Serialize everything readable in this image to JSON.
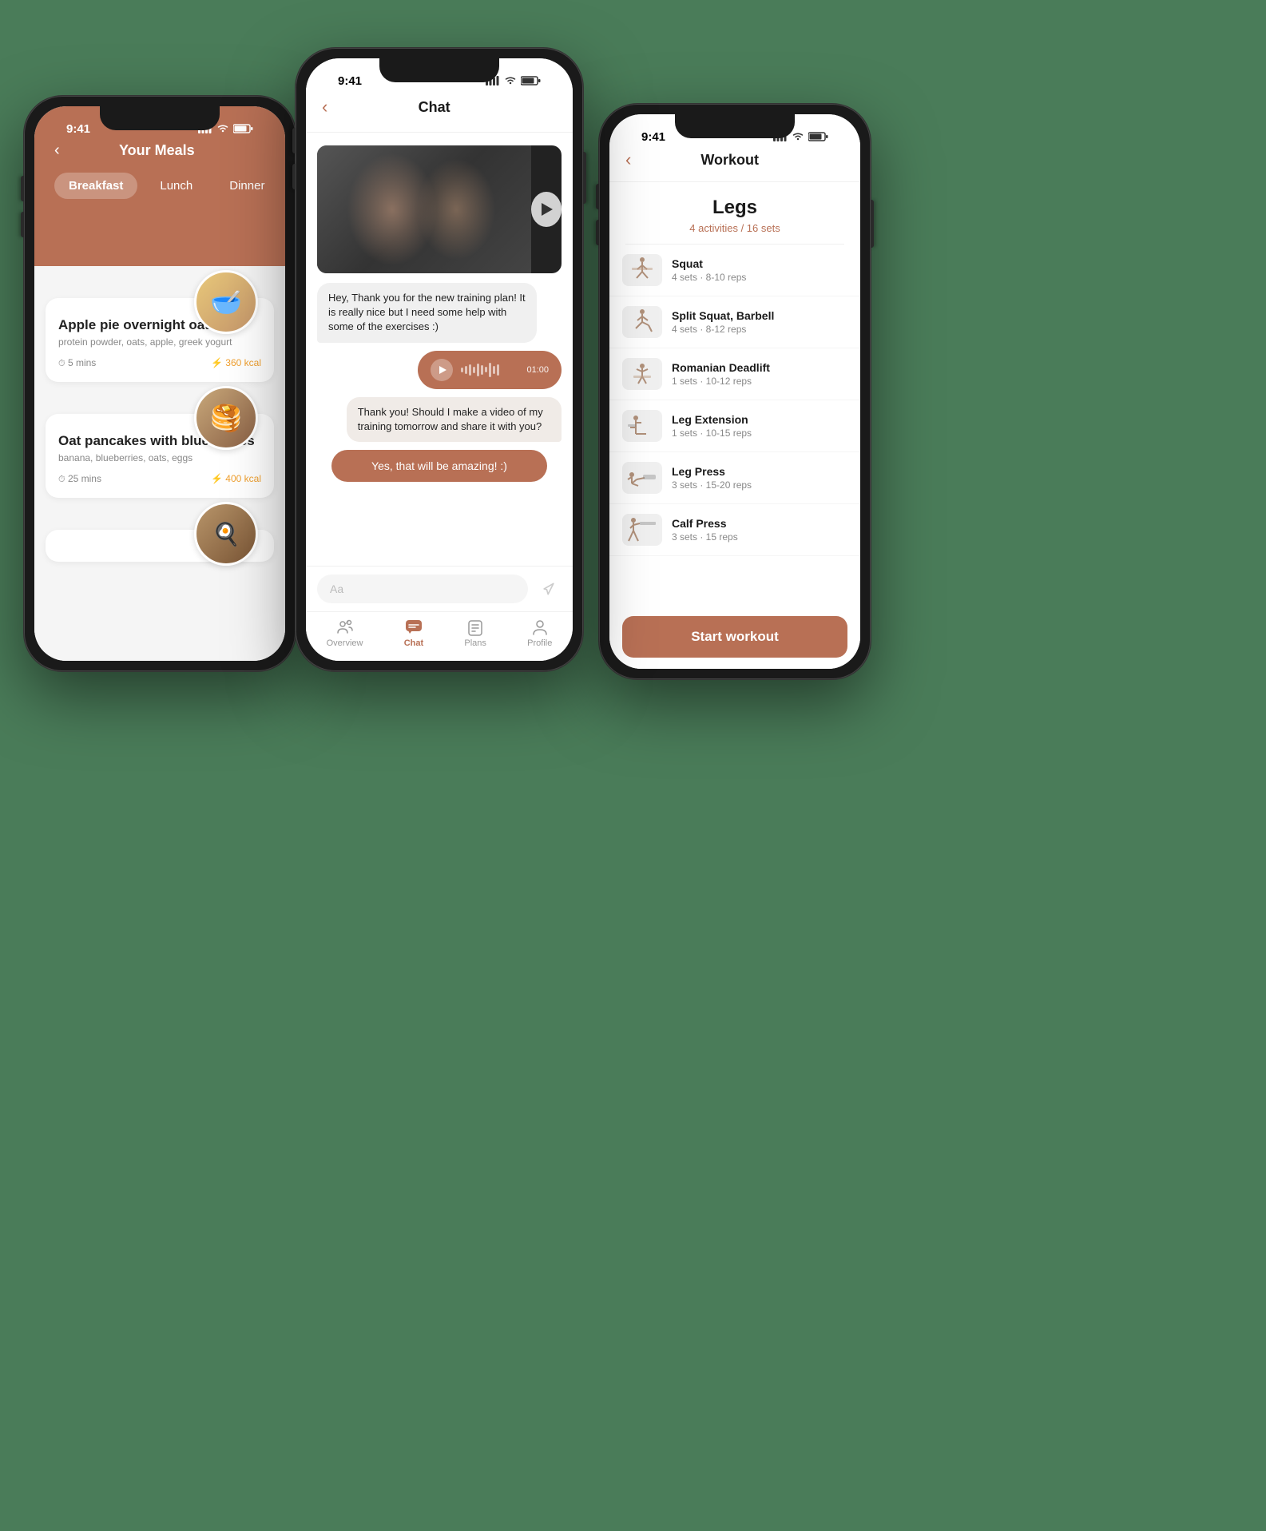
{
  "phone1": {
    "status": {
      "time": "9:41",
      "signal": "●●●",
      "wifi": "wifi",
      "battery": "bat"
    },
    "header": {
      "title": "Your Meals",
      "back_label": "‹"
    },
    "tabs": [
      {
        "id": "breakfast",
        "label": "Breakfast",
        "active": true
      },
      {
        "id": "lunch",
        "label": "Lunch",
        "active": false
      },
      {
        "id": "dinner",
        "label": "Dinner",
        "active": false
      }
    ],
    "meals": [
      {
        "name": "Apple pie overnight oats",
        "ingredients": "protein powder, oats, apple, greek yogurt",
        "time": "5 mins",
        "kcal": "360 kcal",
        "emoji": "🥣"
      },
      {
        "name": "Oat pancakes with blueberries",
        "ingredients": "banana, blueberries, oats, eggs",
        "time": "25 mins",
        "kcal": "400 kcal",
        "emoji": "🥞"
      }
    ]
  },
  "phone2": {
    "status": {
      "time": "9:41"
    },
    "header": {
      "title": "Chat",
      "back_label": "‹"
    },
    "messages": [
      {
        "type": "received",
        "text": "Hey,\nThank you for the new training plan! It is really nice but I need some help with some of the exercises :)"
      },
      {
        "type": "audio",
        "duration": "01:00"
      },
      {
        "type": "sent",
        "text": "Thank you! Should I make a video of my training tomorrow and share it with you?"
      },
      {
        "type": "reply",
        "text": "Yes, that will be amazing! :)"
      }
    ],
    "input_placeholder": "Aa",
    "nav": [
      {
        "id": "overview",
        "label": "Overview",
        "icon": "⊕",
        "active": false
      },
      {
        "id": "chat",
        "label": "Chat",
        "icon": "💬",
        "active": true
      },
      {
        "id": "plans",
        "label": "Plans",
        "icon": "📋",
        "active": false
      },
      {
        "id": "profile",
        "label": "Profile",
        "icon": "👤",
        "active": false
      }
    ]
  },
  "phone3": {
    "status": {
      "time": "9:41"
    },
    "header": {
      "title": "Workout",
      "back_label": "‹"
    },
    "section": {
      "title": "Legs",
      "subtitle": "4 activities / 16 sets"
    },
    "exercises": [
      {
        "name": "Squat",
        "sets": "4 sets · 8-10 reps"
      },
      {
        "name": "Split Squat, Barbell",
        "sets": "4 sets · 8-12 reps"
      },
      {
        "name": "Romanian Deadlift",
        "sets": "1 sets · 10-12 reps"
      },
      {
        "name": "Leg Extension",
        "sets": "1 sets · 10-15 reps"
      },
      {
        "name": "Leg Press",
        "sets": "3 sets · 15-20 reps"
      },
      {
        "name": "Calf Press",
        "sets": "3 sets · 15 reps"
      }
    ],
    "start_button": "Start workout"
  }
}
